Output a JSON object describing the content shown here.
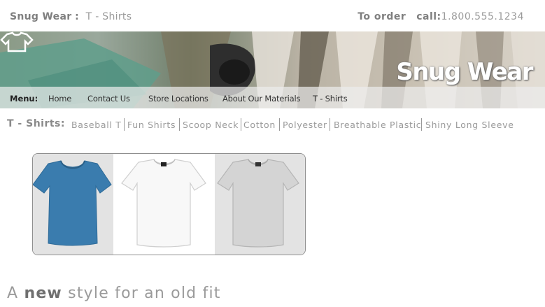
{
  "header": {
    "brand": "Snug Wear",
    "brand_sep": ":",
    "section": "T - Shirts",
    "order_label": "To order",
    "call_label": "call:",
    "phone": "1.800.555.1234"
  },
  "banner": {
    "logo_text": "Snug Wear"
  },
  "menu": {
    "label": "Menu:",
    "items": [
      "Home",
      "Contact Us",
      "Store Locations",
      "About Our Materials",
      "T - Shirts"
    ]
  },
  "subnav": {
    "label": "T - Shirts:",
    "categories": [
      "Baseball T",
      "Fun Shirts",
      "Scoop Neck",
      "Cotton",
      "Polyester",
      "Breathable Plastic",
      "Shiny Long Sleeve"
    ]
  },
  "gallery": {
    "items": [
      {
        "name": "blue scoop neck tee",
        "color": "#3a7cae"
      },
      {
        "name": "white crew tee",
        "color": "#f7f7f7"
      },
      {
        "name": "grey crew tee",
        "color": "#d4d4d4"
      }
    ]
  },
  "tagline": {
    "prefix": "A",
    "emphasis": "new",
    "suffix": "style for an old fit"
  },
  "colors": {
    "menu_bg": "#ebebeb",
    "text_grey": "#8a8a8a",
    "tile_bg": "#e3e3e3"
  }
}
